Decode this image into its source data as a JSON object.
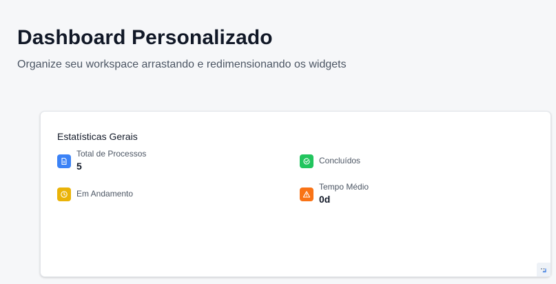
{
  "header": {
    "title": "Dashboard Personalizado",
    "subtitle": "Organize seu workspace arrastando e redimensionando os widgets"
  },
  "widget": {
    "title": "Estatísticas Gerais",
    "stats": [
      {
        "label": "Total de Processos",
        "value": "5",
        "icon": "document-icon",
        "color": "#3b82f6"
      },
      {
        "label": "Concluídos",
        "value": "",
        "icon": "check-circle-icon",
        "color": "#22c55e"
      },
      {
        "label": "Em Andamento",
        "value": "",
        "icon": "clock-icon",
        "color": "#eab308"
      },
      {
        "label": "Tempo Médio",
        "value": "0d",
        "icon": "warning-icon",
        "color": "#f97316"
      }
    ],
    "resize_handle_icon": "resize-handle-icon"
  }
}
